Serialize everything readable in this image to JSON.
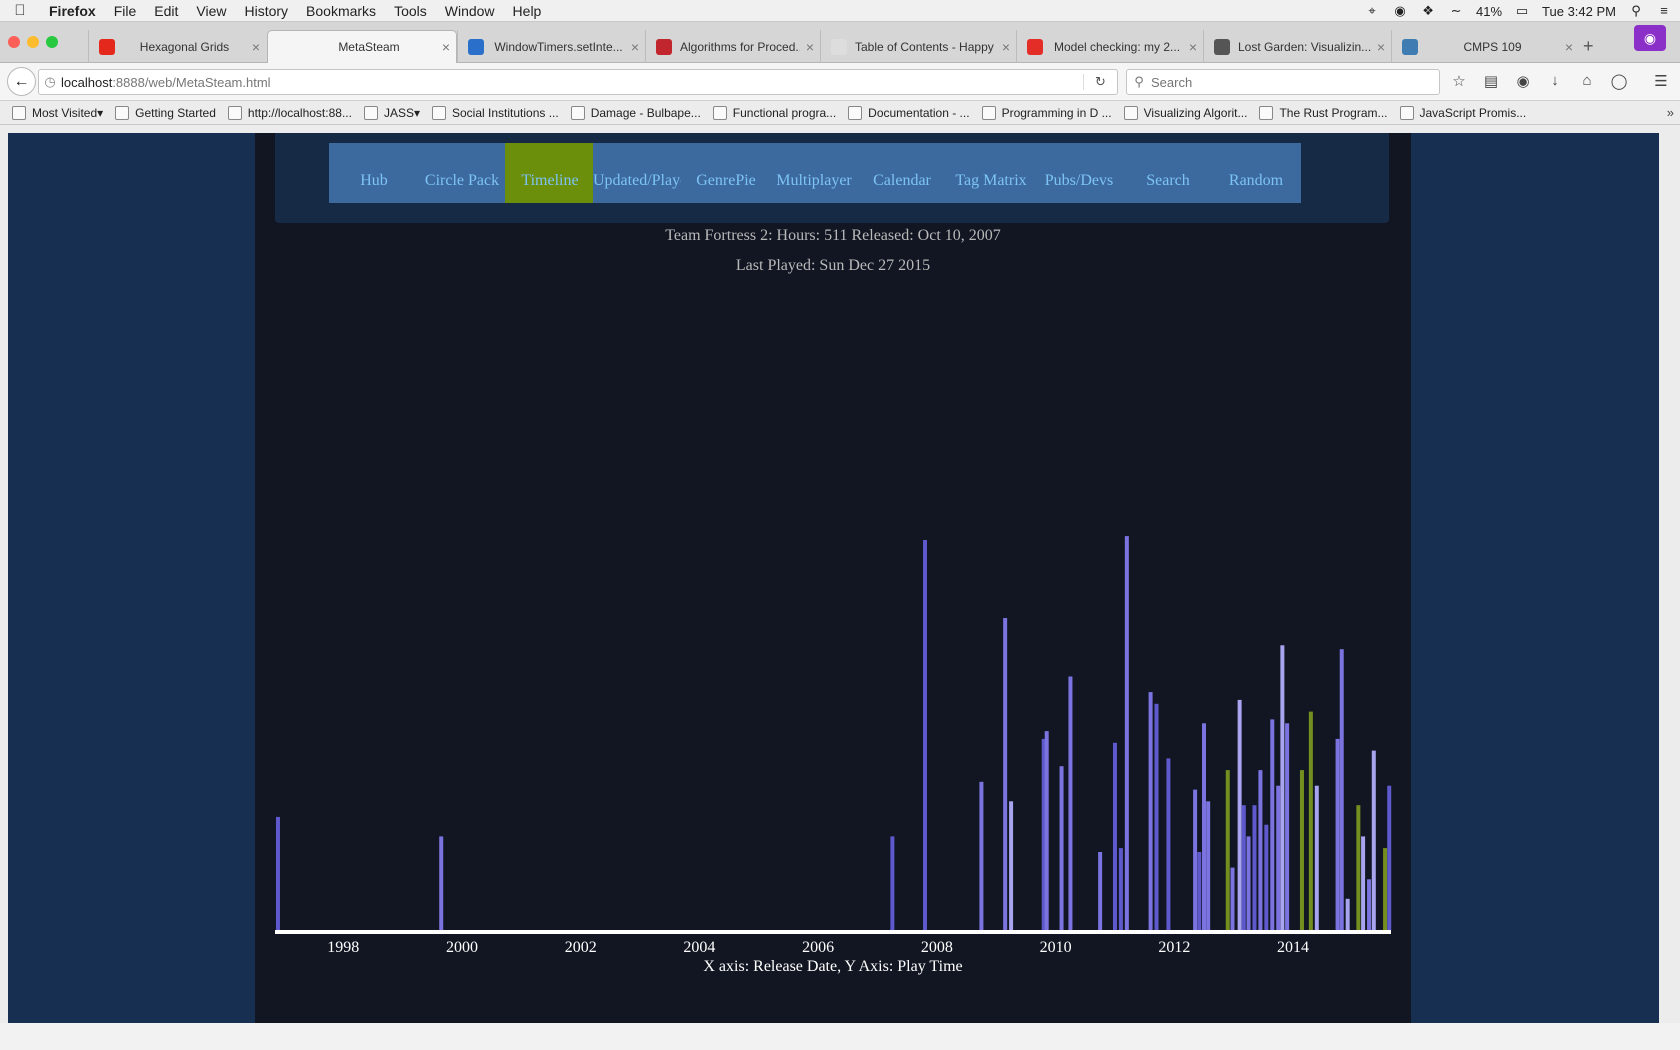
{
  "menubar": {
    "items": [
      "Firefox",
      "File",
      "Edit",
      "View",
      "History",
      "Bookmarks",
      "Tools",
      "Window",
      "Help"
    ],
    "battery": "41%",
    "clock": "Tue 3:42 PM"
  },
  "tabs": [
    {
      "title": "Hexagonal Grids",
      "icon": "red-blob-icon",
      "color": "#e5281c"
    },
    {
      "title": "MetaSteam",
      "icon": "blank-page-icon",
      "color": "#f5f5f5"
    },
    {
      "title": "WindowTimers.setInte...",
      "icon": "mdn-icon",
      "color": "#2a6fc9"
    },
    {
      "title": "Algorithms for Proced...",
      "icon": "red-square-icon",
      "color": "#c0262b"
    },
    {
      "title": "Table of Contents - Happy ...",
      "icon": "blank-page-icon",
      "color": "#dddddd"
    },
    {
      "title": "Model checking: my 2...",
      "icon": "youtube-icon",
      "color": "#e52d27"
    },
    {
      "title": "Lost Garden: Visualizin...",
      "icon": "blogger-eye-icon",
      "color": "#555555"
    },
    {
      "title": "CMPS 109",
      "icon": "piazza-icon",
      "color": "#3e7cb1"
    }
  ],
  "navbar": {
    "url_host": "localhost",
    "url_rest": ":8888/web/MetaSteam.html",
    "search_placeholder": "Search"
  },
  "bookmarks": [
    "Most Visited",
    "Getting Started",
    "http://localhost:88...",
    "JASS",
    "Social Institutions ...",
    "Damage - Bulbape...",
    "Functional progra...",
    "Documentation - ...",
    "Programming in D ...",
    "Visualizing Algorit...",
    "The Rust Program...",
    "JavaScript Promis..."
  ],
  "page": {
    "nav": [
      "Hub",
      "Circle Pack",
      "Timeline",
      "Updated/Played",
      "GenrePie",
      "Multiplayer",
      "Calendar",
      "Tag Matrix",
      "Pubs/Devs",
      "Search",
      "Random"
    ],
    "active_nav": "Timeline",
    "info_line1": "Team Fortress 2: Hours: 511 Released: Oct 10, 2007",
    "info_line2": "Last Played: Sun Dec 27 2015"
  },
  "colors": {
    "bar_blue": "#5e59cc",
    "bar_violet": "#7b74e0",
    "bar_light": "#a9a4f0",
    "bar_olive": "#748f1f",
    "nav_button": "#3c6a9e",
    "nav_active": "#6b8e0b"
  },
  "chart_data": {
    "type": "bar",
    "title": "",
    "xlabel": "X axis: Release Date, Y Axis: Play Time",
    "ylabel": "",
    "x_ticks": [
      "1998",
      "2000",
      "2002",
      "2004",
      "2006",
      "2008",
      "2010",
      "2012",
      "2014"
    ],
    "xlim": [
      1996.85,
      2015.65
    ],
    "ylim": [
      0,
      1
    ],
    "note": "",
    "bars": [
      {
        "x": 1996.9,
        "y": 0.29,
        "c": "blue"
      },
      {
        "x": 1999.65,
        "y": 0.24,
        "c": "violet"
      },
      {
        "x": 2007.25,
        "y": 0.24,
        "c": "blue"
      },
      {
        "x": 2007.8,
        "y": 1.0,
        "c": "blue"
      },
      {
        "x": 2008.75,
        "y": 0.38,
        "c": "violet"
      },
      {
        "x": 2009.15,
        "y": 0.8,
        "c": "violet"
      },
      {
        "x": 2009.25,
        "y": 0.33,
        "c": "light"
      },
      {
        "x": 2009.8,
        "y": 0.49,
        "c": "blue"
      },
      {
        "x": 2009.85,
        "y": 0.51,
        "c": "violet"
      },
      {
        "x": 2010.1,
        "y": 0.42,
        "c": "violet"
      },
      {
        "x": 2010.25,
        "y": 0.65,
        "c": "violet"
      },
      {
        "x": 2010.75,
        "y": 0.2,
        "c": "violet"
      },
      {
        "x": 2011.0,
        "y": 0.48,
        "c": "blue"
      },
      {
        "x": 2011.1,
        "y": 0.21,
        "c": "blue"
      },
      {
        "x": 2011.2,
        "y": 1.01,
        "c": "violet"
      },
      {
        "x": 2011.6,
        "y": 0.61,
        "c": "violet"
      },
      {
        "x": 2011.7,
        "y": 0.58,
        "c": "blue"
      },
      {
        "x": 2011.9,
        "y": 0.44,
        "c": "blue"
      },
      {
        "x": 2012.35,
        "y": 0.36,
        "c": "violet"
      },
      {
        "x": 2012.42,
        "y": 0.2,
        "c": "blue"
      },
      {
        "x": 2012.5,
        "y": 0.53,
        "c": "violet"
      },
      {
        "x": 2012.57,
        "y": 0.33,
        "c": "violet"
      },
      {
        "x": 2012.9,
        "y": 0.41,
        "c": "olive"
      },
      {
        "x": 2012.98,
        "y": 0.16,
        "c": "violet"
      },
      {
        "x": 2013.1,
        "y": 0.59,
        "c": "light"
      },
      {
        "x": 2013.17,
        "y": 0.32,
        "c": "blue"
      },
      {
        "x": 2013.25,
        "y": 0.24,
        "c": "violet"
      },
      {
        "x": 2013.35,
        "y": 0.32,
        "c": "blue"
      },
      {
        "x": 2013.45,
        "y": 0.41,
        "c": "violet"
      },
      {
        "x": 2013.55,
        "y": 0.27,
        "c": "blue"
      },
      {
        "x": 2013.65,
        "y": 0.54,
        "c": "violet"
      },
      {
        "x": 2013.75,
        "y": 0.37,
        "c": "violet"
      },
      {
        "x": 2013.82,
        "y": 0.73,
        "c": "light"
      },
      {
        "x": 2013.9,
        "y": 0.53,
        "c": "violet"
      },
      {
        "x": 2014.15,
        "y": 0.41,
        "c": "olive"
      },
      {
        "x": 2014.3,
        "y": 0.56,
        "c": "olive"
      },
      {
        "x": 2014.4,
        "y": 0.37,
        "c": "light"
      },
      {
        "x": 2014.75,
        "y": 0.49,
        "c": "violet"
      },
      {
        "x": 2014.82,
        "y": 0.72,
        "c": "violet"
      },
      {
        "x": 2014.92,
        "y": 0.08,
        "c": "light"
      },
      {
        "x": 2015.1,
        "y": 0.32,
        "c": "olive"
      },
      {
        "x": 2015.18,
        "y": 0.24,
        "c": "light"
      },
      {
        "x": 2015.28,
        "y": 0.13,
        "c": "violet"
      },
      {
        "x": 2015.36,
        "y": 0.46,
        "c": "light"
      },
      {
        "x": 2015.55,
        "y": 0.21,
        "c": "olive"
      },
      {
        "x": 2015.62,
        "y": 0.37,
        "c": "blue"
      }
    ]
  }
}
